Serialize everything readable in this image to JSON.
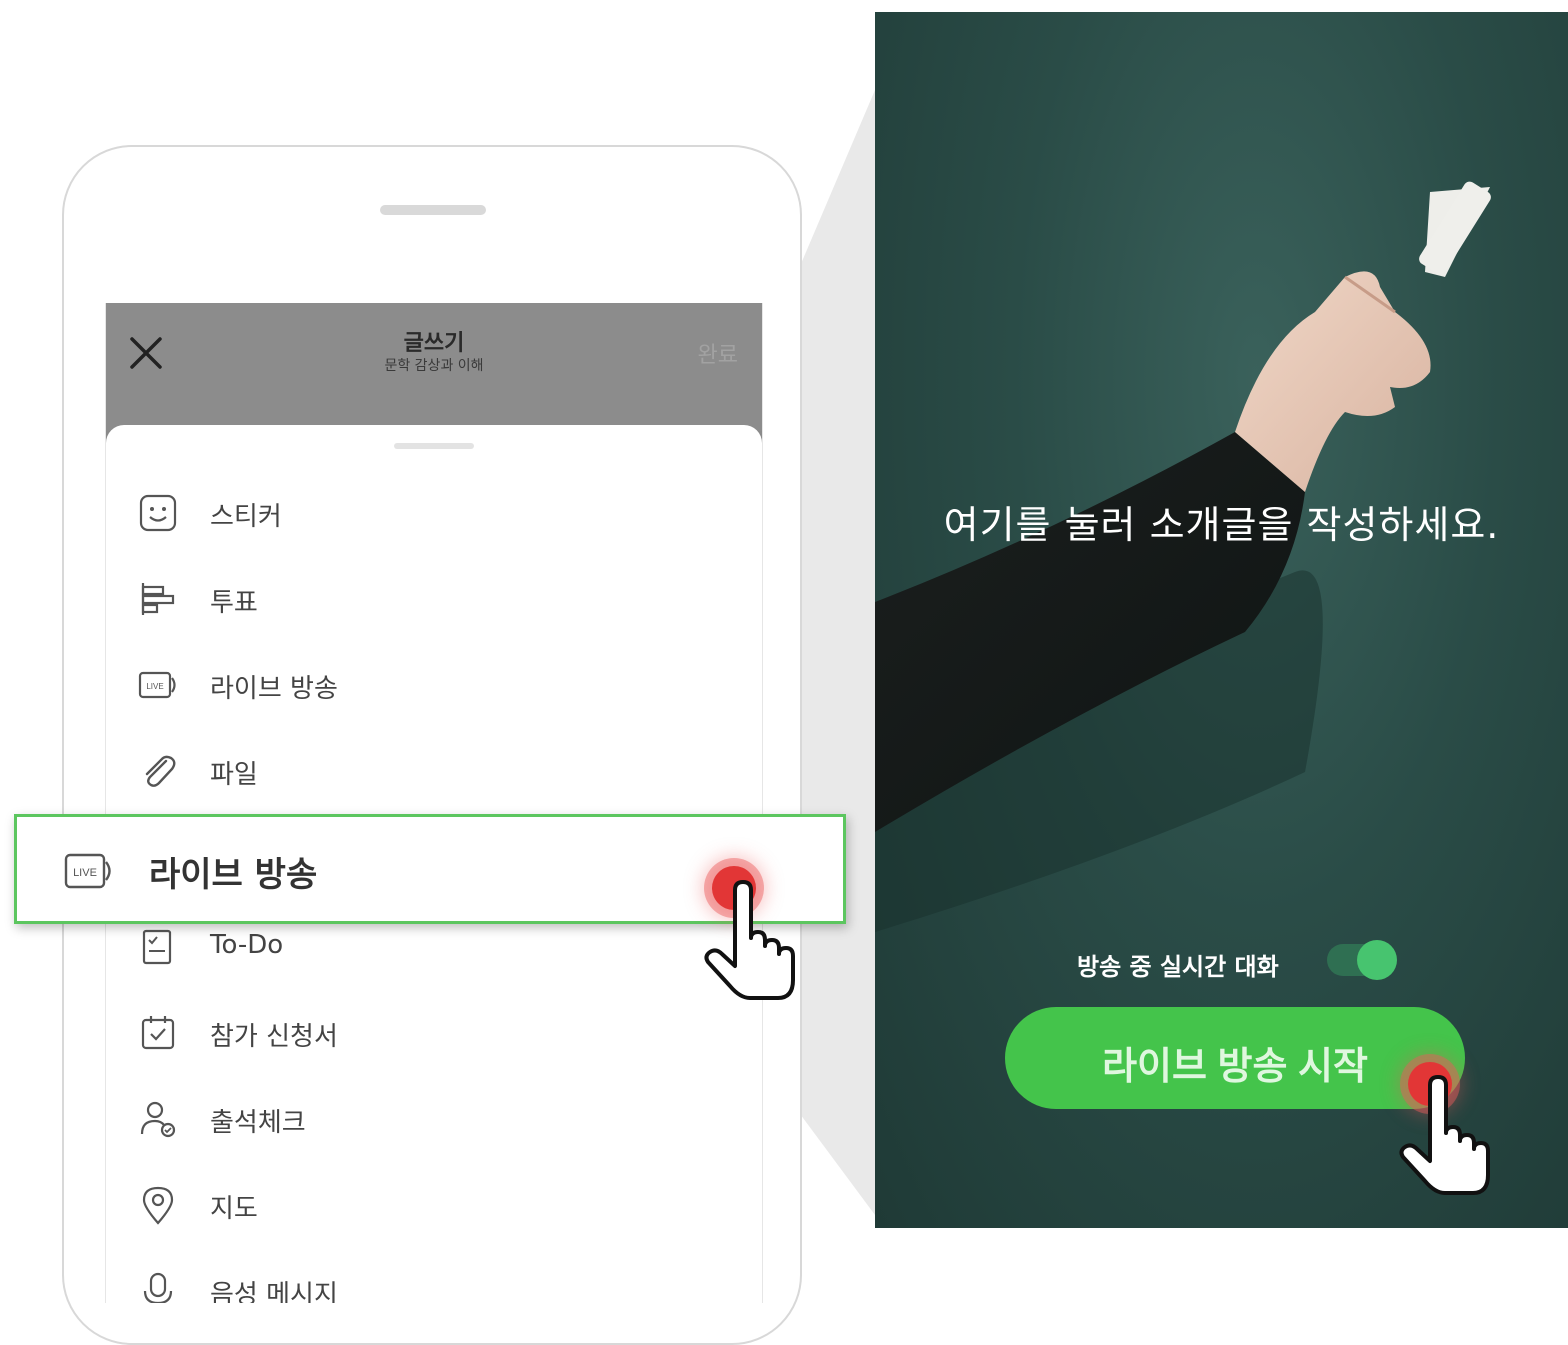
{
  "header": {
    "title": "글쓰기",
    "subtitle": "문학 감상과 이해",
    "done_label": "완료"
  },
  "menu": {
    "items": [
      {
        "label": "스티커",
        "icon": "sticker-icon"
      },
      {
        "label": "투표",
        "icon": "vote-icon"
      },
      {
        "label": "라이브 방송",
        "icon": "live-icon"
      },
      {
        "label": "파일",
        "icon": "paperclip-icon"
      },
      {
        "label": "To-Do",
        "icon": "todo-icon"
      },
      {
        "label": "참가 신청서",
        "icon": "application-form-icon"
      },
      {
        "label": "출석체크",
        "icon": "attendance-icon"
      },
      {
        "label": "지도",
        "icon": "map-pin-icon"
      },
      {
        "label": "음성 메시지",
        "icon": "voice-message-icon"
      }
    ]
  },
  "highlight": {
    "label": "라이브 방송",
    "icon": "live-icon"
  },
  "live_panel": {
    "intro_text": "여기를 눌러 소개글을 작성하세요.",
    "chat_toggle_label": "방송 중 실시간 대화",
    "chat_toggle_on": true,
    "start_button_label": "라이브 방송 시작"
  },
  "colors": {
    "accent_green": "#44c44b",
    "highlight_border": "#5cc65f",
    "panel_bg": "#2a4c47",
    "tap_red": "#e23636"
  }
}
